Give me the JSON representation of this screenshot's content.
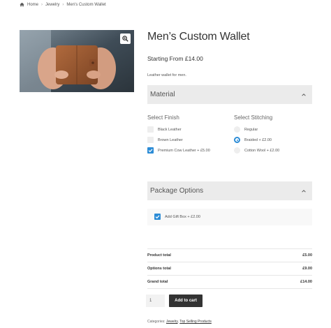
{
  "breadcrumb": {
    "home": "Home",
    "sep1": "›",
    "category": "Jewelry",
    "sep2": "›",
    "current": "Men’s Custom Wallet"
  },
  "product": {
    "title": "Men’s Custom Wallet",
    "price": "Starting From £14.00",
    "short_description": "Leather wallet for men."
  },
  "material_section": {
    "label": "Material",
    "finish": {
      "title": "Select Finish",
      "options": [
        {
          "label": "Black Leather",
          "checked": false
        },
        {
          "label": "Brown Leather",
          "checked": false
        },
        {
          "label": "Premium Cow Leather + £5.00",
          "checked": true
        }
      ]
    },
    "stitching": {
      "title": "Select Stitching",
      "options": [
        {
          "label": "Regular",
          "selected": false
        },
        {
          "label": "Braided + £2.00",
          "selected": true
        },
        {
          "label": "Cotton Wool + £2.00",
          "selected": false
        }
      ]
    }
  },
  "package_section": {
    "label": "Package Options",
    "gift_box": {
      "label": "Add Gift Box + £2.00",
      "checked": true
    }
  },
  "totals": {
    "product_total_label": "Product total",
    "product_total": "£5.00",
    "options_total_label": "Options total",
    "options_total": "£9.00",
    "grand_total_label": "Grand total",
    "grand_total": "£14.00"
  },
  "cart": {
    "quantity": "1",
    "add_to_cart": "Add to cart"
  },
  "categories": {
    "label": "Categories:",
    "items": [
      "Jewelry",
      "Top Selling Products"
    ],
    "separator": ","
  },
  "colors": {
    "accent": "#2c8cd6",
    "button": "#333333",
    "panel": "#ebebeb"
  }
}
